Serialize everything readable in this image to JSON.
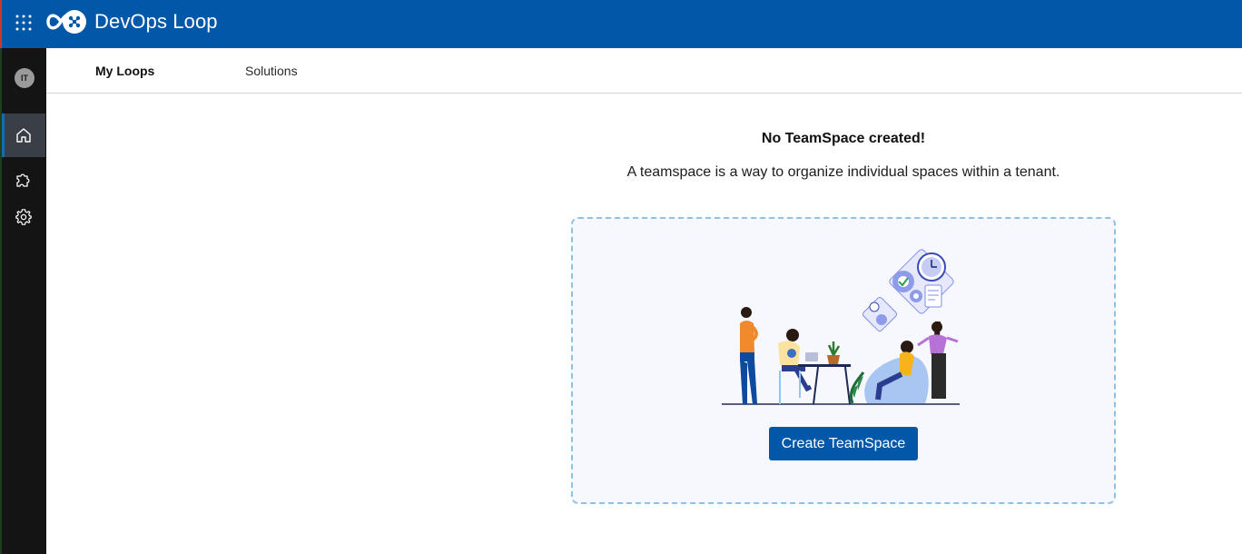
{
  "header": {
    "app_title": "DevOps Loop",
    "apps_icon": "grid-9-dots-icon",
    "logo_icon": "devops-loop-logo-icon",
    "bar_color": "#0158a8"
  },
  "left_rail": {
    "avatar_initials": "IT",
    "items": [
      {
        "id": "home",
        "icon": "home-icon",
        "active": true
      },
      {
        "id": "extensions",
        "icon": "puzzle-icon",
        "active": false
      },
      {
        "id": "settings",
        "icon": "gear-icon",
        "active": false
      }
    ]
  },
  "tabs": [
    {
      "label": "My Loops",
      "active": true
    },
    {
      "label": "Solutions",
      "active": false
    }
  ],
  "empty_state": {
    "title": "No TeamSpace created!",
    "description": "A teamspace is a way to organize individual spaces within a tenant.",
    "illustration_icon": "team-collaboration-illustration",
    "button_label": "Create TeamSpace"
  }
}
